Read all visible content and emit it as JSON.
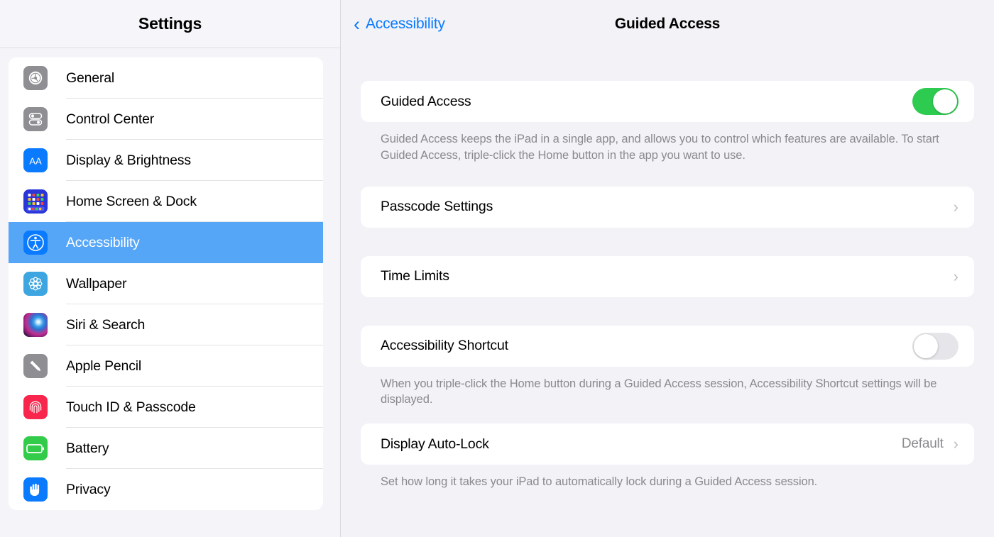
{
  "sidebar": {
    "title": "Settings",
    "items": [
      {
        "label": "General",
        "icon": "gear-icon",
        "selected": false
      },
      {
        "label": "Control Center",
        "icon": "sliders-icon",
        "selected": false
      },
      {
        "label": "Display & Brightness",
        "icon": "text-size-aa-icon",
        "selected": false
      },
      {
        "label": "Home Screen & Dock",
        "icon": "app-grid-icon",
        "selected": false
      },
      {
        "label": "Accessibility",
        "icon": "accessibility-icon",
        "selected": true
      },
      {
        "label": "Wallpaper",
        "icon": "flower-icon",
        "selected": false
      },
      {
        "label": "Siri & Search",
        "icon": "siri-orb-icon",
        "selected": false
      },
      {
        "label": "Apple Pencil",
        "icon": "pencil-icon",
        "selected": false
      },
      {
        "label": "Touch ID & Passcode",
        "icon": "fingerprint-icon",
        "selected": false
      },
      {
        "label": "Battery",
        "icon": "battery-icon",
        "selected": false
      },
      {
        "label": "Privacy",
        "icon": "hand-icon",
        "selected": false
      }
    ]
  },
  "header": {
    "back_label": "Accessibility",
    "back_icon": "chevron-left-icon",
    "title": "Guided Access"
  },
  "main": {
    "guided_access": {
      "label": "Guided Access",
      "toggle_state": "on",
      "footnote": "Guided Access keeps the iPad in a single app, and allows you to control which features are available. To start Guided Access, triple-click the Home button in the app you want to use."
    },
    "passcode_settings": {
      "label": "Passcode Settings",
      "chevron": "chevron-right-icon"
    },
    "time_limits": {
      "label": "Time Limits",
      "chevron": "chevron-right-icon"
    },
    "accessibility_shortcut": {
      "label": "Accessibility Shortcut",
      "toggle_state": "off",
      "footnote": "When you triple-click the Home button during a Guided Access session, Accessibility Shortcut settings will be displayed."
    },
    "display_auto_lock": {
      "label": "Display Auto-Lock",
      "value": "Default",
      "chevron": "chevron-right-icon",
      "footnote": "Set how long it takes your iPad to automatically lock during a Guided Access session."
    }
  },
  "colors": {
    "accent_blue": "#0a7aff",
    "selection_blue": "#56a6f8",
    "toggle_on_green": "#2ecb51",
    "toggle_off_gray": "#e6e6ea",
    "page_background": "#f2f2f7",
    "card_white": "#ffffff",
    "secondary_text": "#8a8a8e"
  }
}
